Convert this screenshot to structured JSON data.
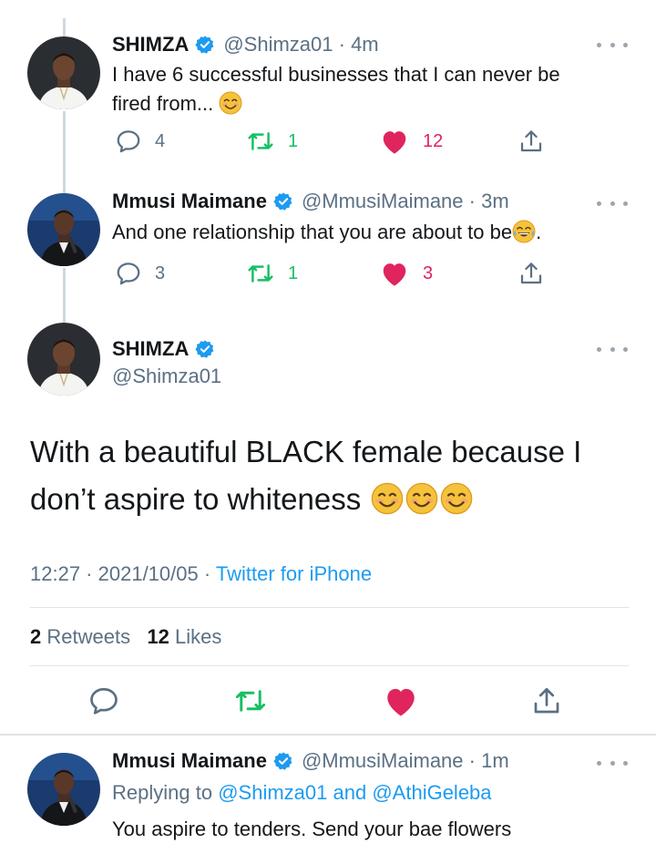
{
  "tweets": [
    {
      "name": "SHIMZA",
      "handle": "@Shimza01",
      "time": "4m",
      "text_line1": "I have 6 successful businesses that I can never be",
      "text_line2": "fired from...",
      "emoji": "smiling-face-emoji",
      "replies": "4",
      "retweets": "1",
      "likes": "12"
    },
    {
      "name": "Mmusi Maimane",
      "handle": "@MmusiMaimane",
      "time": "3m",
      "text": "And one relationship that you are about to be",
      "text_after_emoji": ".",
      "emoji": "tears-of-joy-emoji",
      "replies": "3",
      "retweets": "1",
      "likes": "3"
    }
  ],
  "main_tweet": {
    "name": "SHIMZA",
    "handle": "@Shimza01",
    "text_line1": "With a beautiful BLACK female because I",
    "text_line2": "don’t aspire to whiteness",
    "emojis": [
      "smiling-face-emoji",
      "smiling-face-emoji",
      "smiling-face-emoji"
    ],
    "time": "12:27",
    "date": "2021/10/05",
    "source": "Twitter for iPhone",
    "retweet_count": "2",
    "retweet_label": "Retweets",
    "like_count": "12",
    "like_label": "Likes"
  },
  "reply": {
    "name": "Mmusi Maimane",
    "handle": "@MmusiMaimane",
    "time": "1m",
    "replying_label": "Replying to",
    "mention1": "@Shimza01",
    "and_label": "and",
    "mention2": "@AthiGeleba",
    "text": "You aspire to tenders. Send your bae flowers"
  },
  "colors": {
    "accent_blue": "#1d9bf0",
    "retweet_green": "#17bf63",
    "like_red": "#e0245e",
    "secondary_text": "#5b7083"
  }
}
